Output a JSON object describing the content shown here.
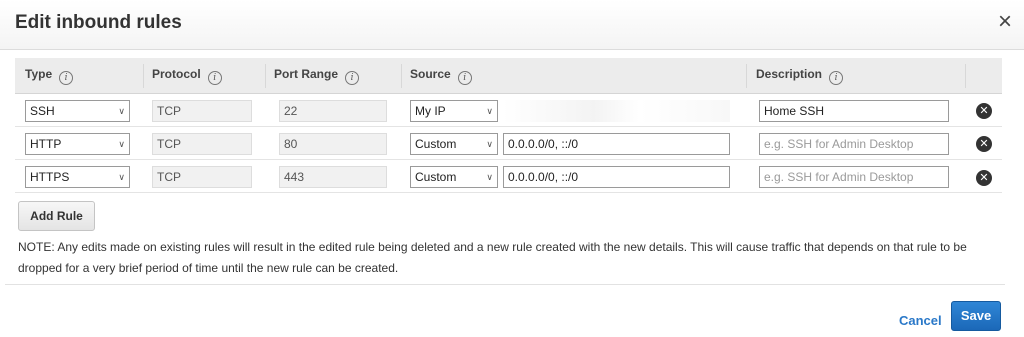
{
  "dialog": {
    "title": "Edit inbound rules",
    "close_glyph": "×"
  },
  "table": {
    "headers": {
      "type": "Type",
      "protocol": "Protocol",
      "port_range": "Port Range",
      "source": "Source",
      "description": "Description"
    },
    "info_glyph": "i",
    "rows": [
      {
        "type": "SSH",
        "protocol": "TCP",
        "port_range": "22",
        "source_mode": "My IP",
        "source_value": "",
        "description": "Home SSH",
        "description_placeholder": ""
      },
      {
        "type": "HTTP",
        "protocol": "TCP",
        "port_range": "80",
        "source_mode": "Custom",
        "source_value": "0.0.0.0/0, ::/0",
        "description": "",
        "description_placeholder": "e.g. SSH for Admin Desktop"
      },
      {
        "type": "HTTPS",
        "protocol": "TCP",
        "port_range": "443",
        "source_mode": "Custom",
        "source_value": "0.0.0.0/0, ::/0",
        "description": "",
        "description_placeholder": "e.g. SSH for Admin Desktop"
      }
    ]
  },
  "add_rule_label": "Add Rule",
  "note": "NOTE: Any edits made on existing rules will result in the edited rule being deleted and a new rule created with the new details. This will cause traffic that depends on that rule to be dropped for a very brief period of time until the new rule can be created.",
  "footer": {
    "cancel_label": "Cancel",
    "save_label": "Save"
  },
  "icons": {
    "dropdown": "chevron-down-icon",
    "info": "info-icon",
    "delete": "delete-circle-icon",
    "close": "close-icon"
  },
  "colors": {
    "primary_button": "#1f6fc0",
    "link": "#2a78c8",
    "header_bg": "#ececec"
  }
}
